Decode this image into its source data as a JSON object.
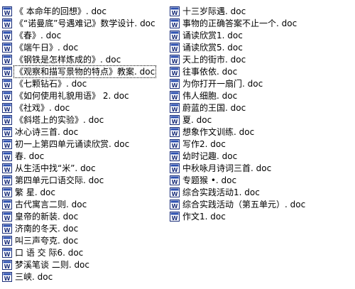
{
  "left_files": [
    "《 本命年的回想》. doc",
    "《“诺曼底”号遇难记》数学设计. doc",
    "《春》. doc",
    "《端午日》. doc",
    "《钢铁是怎样炼成的》. doc",
    "《观察和描写景物的特点》教案. doc",
    "《七颗钻石》. doc",
    "《如何使用礼貌用语》 2. doc",
    "《社戏》. doc",
    "《斜塔上的实验》. doc",
    "冰心诗三首. doc",
    "初一上第四单元诵读欣赏. doc",
    "春. doc",
    "从生活中找“米”. doc",
    "第四单元口语交际. doc",
    "繁  星. doc",
    "古代寓言二则. doc",
    "皇帝的新装. doc",
    "济南的冬天. doc",
    "叫三声夸克. doc",
    "口 语 交 际6. doc",
    "梦溪笔谈 二则. doc",
    "三峡. doc"
  ],
  "right_files": [
    "十三岁际遇. doc",
    "事物的正确答案不止一个. doc",
    "诵读欣赏1. doc",
    "诵读欣赏5. doc",
    "天上的街市. doc",
    "往事依依. doc",
    "为你打开一扇门. doc",
    "伟人细胞. doc",
    "蔚蓝的王国. doc",
    "夏. doc",
    "想象作文训练. doc",
    "写作2. doc",
    "幼时记趣. doc",
    "中秋咏月诗词三首. doc",
    "专题猴 •. doc",
    "综合实践活动1. doc",
    "综合实践活动（第五单元）. doc",
    "作文1. doc"
  ],
  "selected_index_left": 5,
  "icon": "word-document-icon",
  "colors": {
    "icon_blue": "#2b4fb0",
    "icon_border": "#1b2f7a",
    "selection_outline": "#000000"
  }
}
